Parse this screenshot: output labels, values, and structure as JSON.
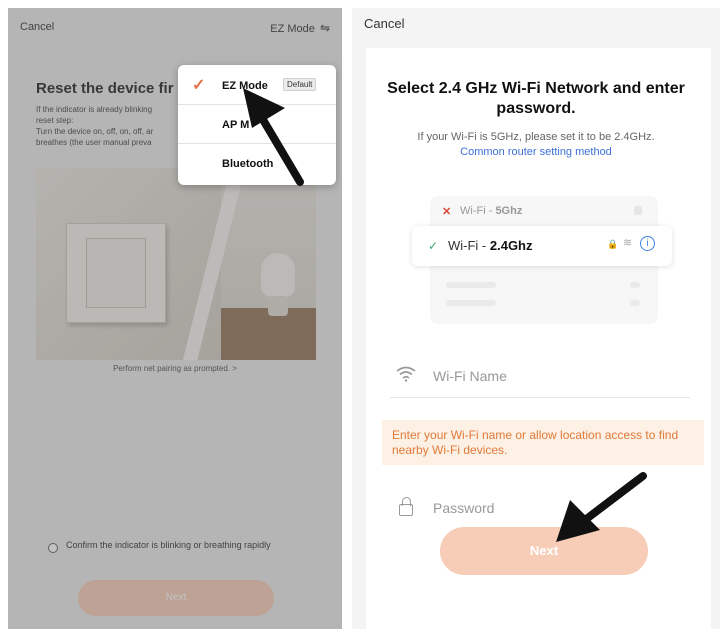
{
  "left": {
    "cancel": "Cancel",
    "mode_label": "EZ Mode",
    "mode_icon": "⇋",
    "title": "Reset the device fir",
    "desc_lines": [
      "If the indicator is already blinking",
      "reset step:",
      "Turn the device on, off, on, off, ar",
      "breathes (the user manual preva"
    ],
    "prompt": "Perform net pairing as prompted. >",
    "confirm": "Confirm the indicator is blinking or breathing rapidly",
    "next": "Next",
    "menu": [
      {
        "label": "EZ Mode",
        "badge": "Default",
        "checked": true
      },
      {
        "label": "AP M"
      },
      {
        "label": "Bluetooth"
      }
    ]
  },
  "right": {
    "cancel": "Cancel",
    "title": "Select 2.4 GHz Wi-Fi Network and enter password.",
    "subtitle": "If your Wi-Fi is 5GHz, please set it to be 2.4GHz.",
    "link": "Common router setting method",
    "wifi_5g_prefix": "Wi-Fi - ",
    "wifi_5g": "5Ghz",
    "wifi_24_prefix": "Wi-Fi - ",
    "wifi_24": "2.4Ghz",
    "wifi_name_placeholder": "Wi-Fi Name",
    "warning": "Enter your Wi-Fi name or allow location access to find nearby Wi-Fi devices.",
    "password_placeholder": "Password",
    "next": "Next"
  },
  "colors": {
    "accent": "#e8734a",
    "link": "#3d6fd6",
    "next_button": "#f7cdb7",
    "warning_bg": "#fdf0e4",
    "warning_text": "#e07a3a"
  }
}
